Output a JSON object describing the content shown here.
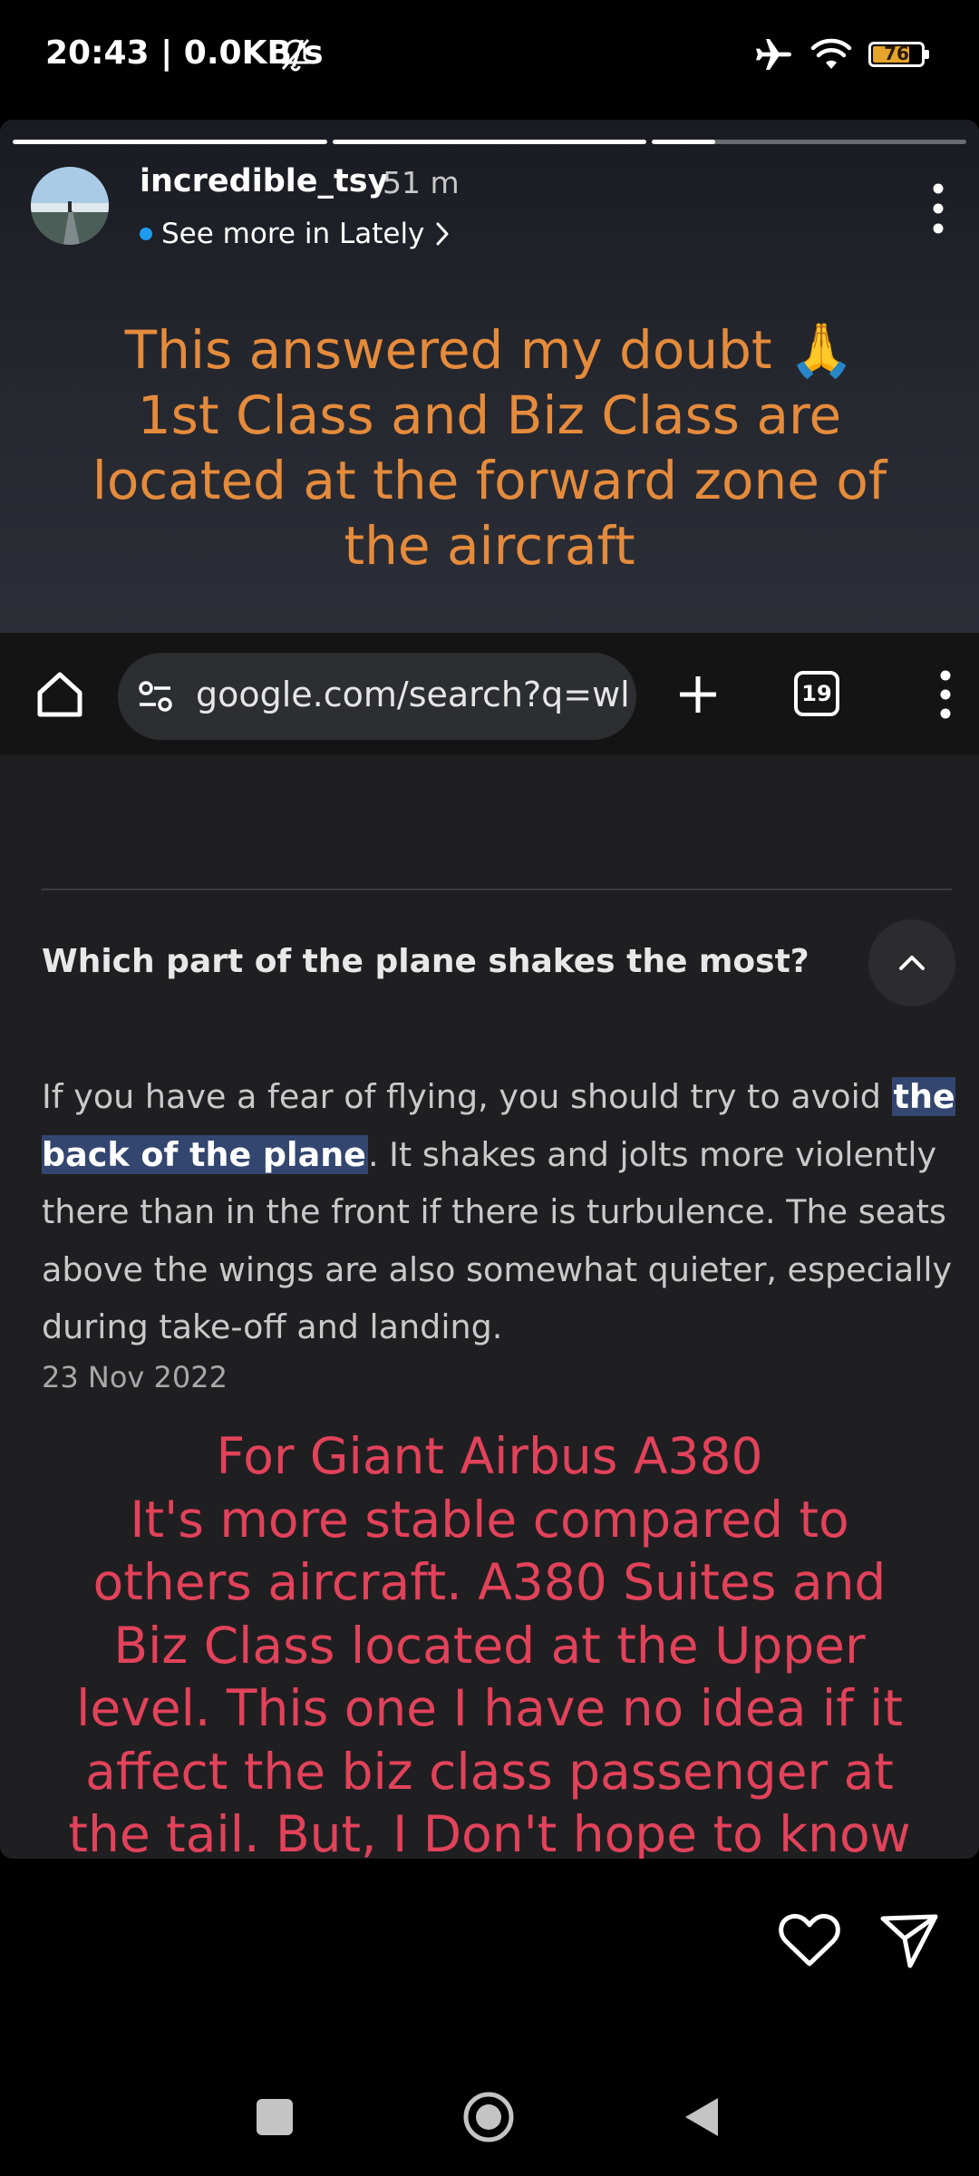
{
  "status_bar": {
    "time": "20:43 | 0.0KB/s",
    "battery_level": "76",
    "battery_fraction": 0.76,
    "icons": [
      "bell-off-icon",
      "airplane-icon",
      "wifi-icon",
      "battery-icon"
    ]
  },
  "story": {
    "progress_fractions": [
      1,
      1,
      0.2
    ],
    "username": "incredible_tsy",
    "time_ago": "51 m",
    "see_more_label": "See more in Lately",
    "caption_top": "This answered my doubt 🙏\n1st Class and Biz Class are located at the forward zone of the aircraft",
    "caption_top_color": "#e58b3c",
    "caption_bottom": "For Giant Airbus A380\nIt's more stable compared to others aircraft. A380 Suites and Biz Class located at the Upper level. This one I have no idea if it affect the biz class passenger at the tail. But, I Don't hope to know the answer, safe flight",
    "caption_bottom_color": "#e2425a"
  },
  "browser": {
    "url": "google.com/search?q=wl",
    "tab_count": "19"
  },
  "search_result": {
    "question": "Which part of the plane shakes the most?",
    "answer_before": "If you have a fear of flying, you should try to avoid ",
    "answer_highlight": "the back of the plane",
    "answer_after": ". It shakes and jolts more violently there than in the front if there is turbulence. The seats above the wings are also somewhat quieter, especially during take-off and landing.",
    "date": "23 Nov 2022",
    "highlight_color": "#33466f"
  },
  "actions": {
    "icons": [
      "heart-icon",
      "send-icon"
    ]
  },
  "nav_bar": {
    "icons": [
      "recents-icon",
      "home-icon",
      "back-icon"
    ]
  }
}
